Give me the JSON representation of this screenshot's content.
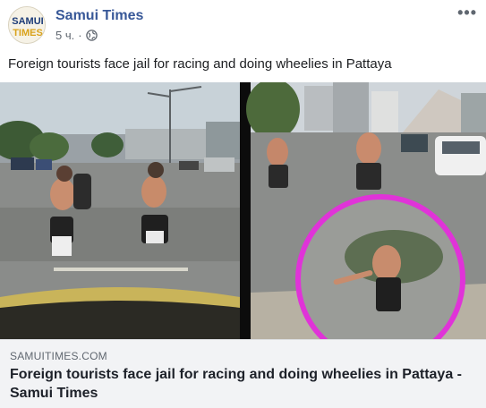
{
  "post": {
    "page_name": "Samui Times",
    "timestamp": "5 ч.",
    "separator": "·",
    "privacy_icon": "globe-icon",
    "more_icon": "more-icon",
    "text": "Foreign tourists face jail for racing and doing wheelies in Pattaya"
  },
  "avatar": {
    "logo_line1": "SAMUI",
    "logo_line2": "TIMES"
  },
  "link_preview": {
    "domain": "SAMUITIMES.COM",
    "title": "Foreign tourists face jail for racing and doing wheelies in Pattaya - Samui Times"
  },
  "colors": {
    "page_name": "#385898",
    "meta_text": "#606770",
    "link_bg": "#f2f3f5",
    "highlight_circle": "#e033d8"
  }
}
